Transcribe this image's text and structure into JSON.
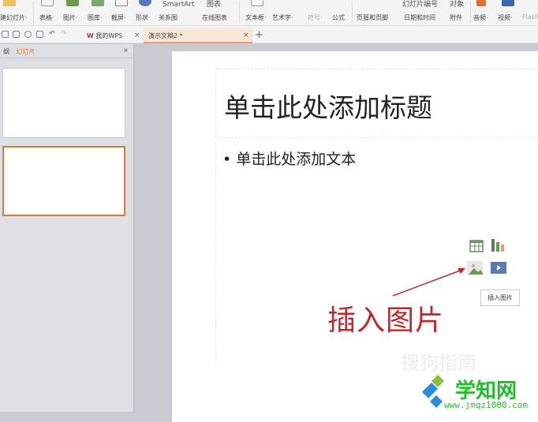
{
  "ribbon": {
    "top": [
      "SmartArt",
      "图表",
      "幻灯片编号",
      "对象"
    ],
    "buttons": [
      "建幻灯片·",
      "表格·",
      "图片·",
      "图库·",
      "截屏·",
      "形状·",
      "关系图",
      "在线图表",
      "文本框·",
      "艺术字·",
      "符号·",
      "公式",
      "页眉和页脚",
      "日期和时间",
      "附件",
      "音频·",
      "视频·",
      "Flash"
    ]
  },
  "tabs": {
    "wps": "我的WPS",
    "doc": "演示文稿2 *",
    "close": "×",
    "add": "+"
  },
  "panel": {
    "outline": "纲",
    "slides": "幻灯片",
    "close": "×"
  },
  "slide": {
    "title": "单击此处添加标题",
    "body": "• 单击此处添加文本"
  },
  "tooltip": "插入图片",
  "annotation": "插入图片",
  "watermark": "搜狗指南",
  "logo": {
    "name": "学知网",
    "url": "www.jmqz1000.com"
  },
  "colors": {
    "accent": "#e07a30",
    "annotation": "#c0282e",
    "logo": "#1fbf2a"
  }
}
